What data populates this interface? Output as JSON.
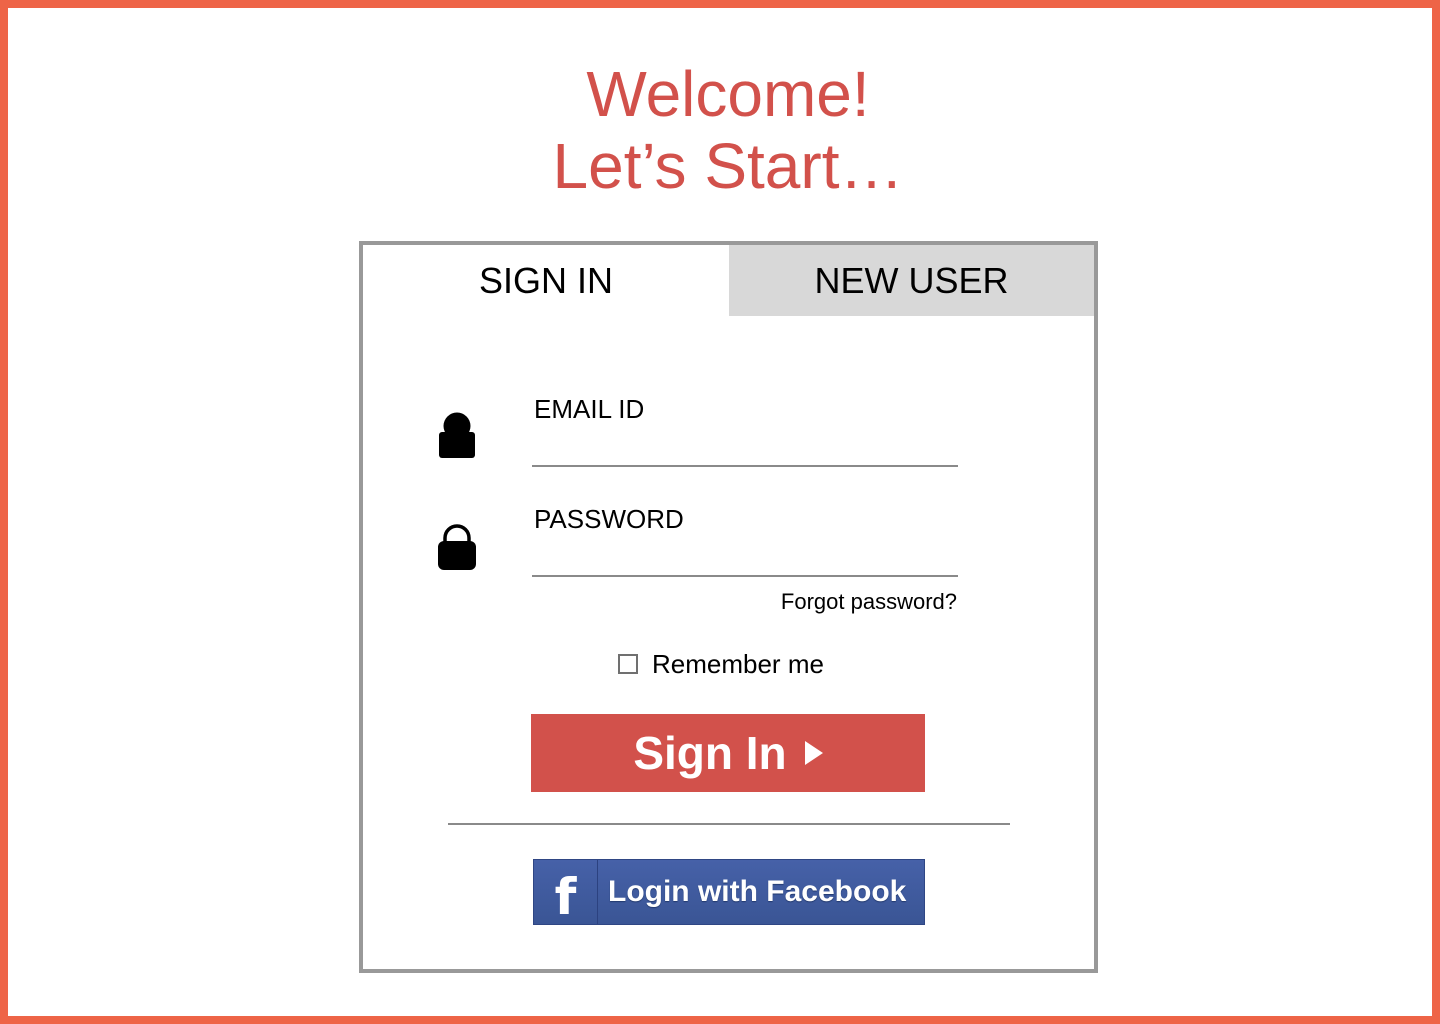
{
  "header": {
    "line1": "Welcome!",
    "line2": "Let’s Start…"
  },
  "tabs": {
    "sign_in": "SIGN IN",
    "new_user": "NEW USER",
    "active": "sign_in"
  },
  "form": {
    "email": {
      "label": "EMAIL ID",
      "value": "",
      "icon": "user-icon"
    },
    "password": {
      "label": "PASSWORD",
      "value": "",
      "icon": "lock-icon"
    },
    "forgot_password": "Forgot password?",
    "remember_me": {
      "label": "Remember me",
      "checked": false
    },
    "submit_label": "Sign In",
    "facebook_label": "Login with Facebook"
  },
  "colors": {
    "frame_border": "#ee6447",
    "accent": "#d2514b",
    "inactive_tab": "#d8d8d8",
    "facebook_blue": "#3b5998"
  }
}
